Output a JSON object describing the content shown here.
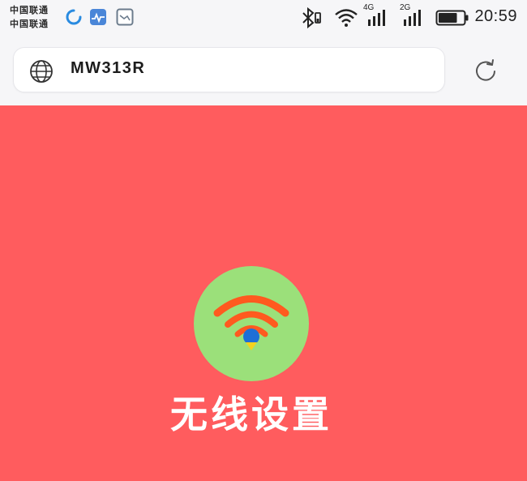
{
  "status_bar": {
    "carrier_1": "中国联通",
    "carrier_2": "中国联通",
    "network_1": "4G",
    "network_2": "2G",
    "time": "20:59",
    "battery_level": 0.75,
    "icons": [
      "loading-icon",
      "health-app-icon",
      "image-app-icon",
      "bluetooth-icon",
      "wifi-signal-icon",
      "cell-signal-icon",
      "battery-icon"
    ]
  },
  "browser": {
    "url": "MW313R",
    "icons": [
      "globe-icon",
      "reload-icon"
    ]
  },
  "page": {
    "background_color": "#ff5c5e",
    "badge_color": "#9be07a",
    "wifi_arc_color": "#ff5a1f",
    "wifi_dot_color": "#1e6fd6",
    "title": "无线设置"
  }
}
